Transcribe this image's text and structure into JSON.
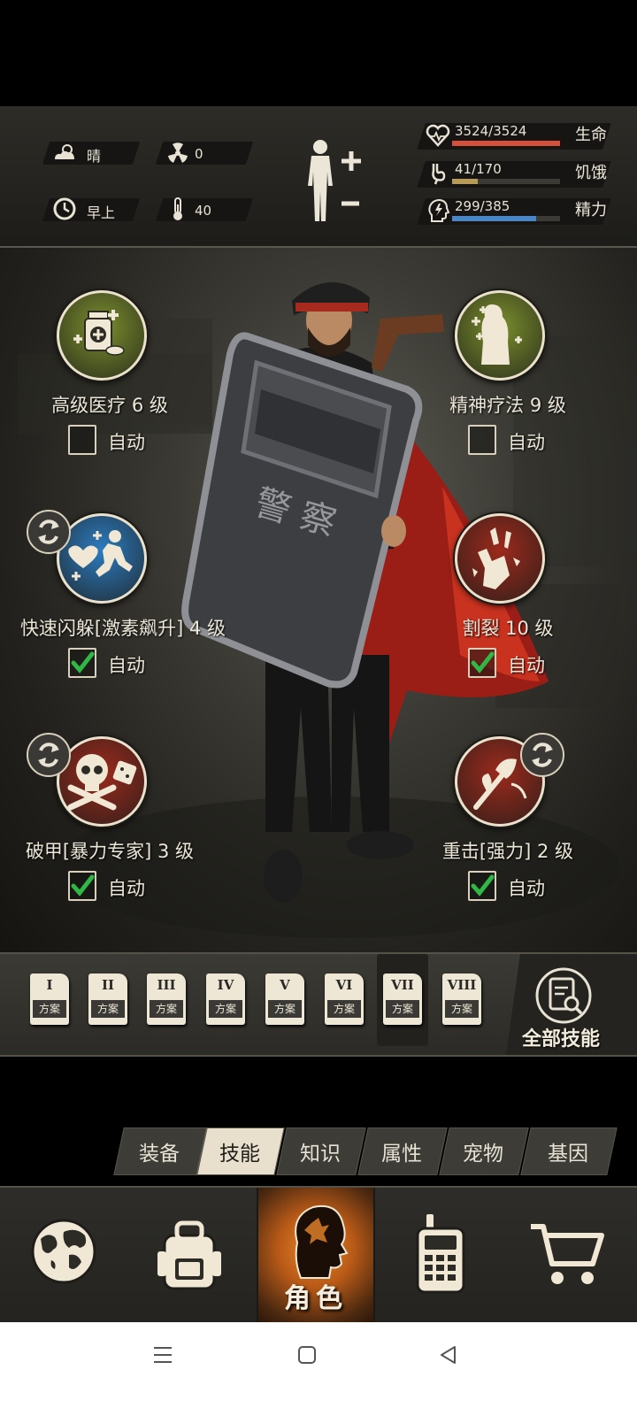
{
  "hud": {
    "weather": "晴",
    "radiation": "0",
    "time_of_day": "早上",
    "temperature": "40",
    "stats": [
      {
        "value": "3524/3524",
        "name": "生命",
        "fill": 1.0,
        "color": "#d4503c",
        "icon": "heart-icon"
      },
      {
        "value": "41/170",
        "name": "饥饿",
        "fill": 0.24,
        "color": "#b89a58",
        "icon": "stomach-icon"
      },
      {
        "value": "299/385",
        "name": "精力",
        "fill": 0.78,
        "color": "#4a86c6",
        "icon": "head-energy-icon"
      }
    ]
  },
  "skills": [
    {
      "name": "高级医疗 6 级",
      "auto_label": "自动",
      "auto": false,
      "swappable": false,
      "icon": "medkit-icon",
      "color": "#7a8f2c"
    },
    {
      "name": "精神疗法 9 级",
      "auto_label": "自动",
      "auto": false,
      "swappable": false,
      "icon": "ghost-heal-icon",
      "color": "#7a8f2c"
    },
    {
      "name": "快速闪躲[激素飙升] 4 级",
      "auto_label": "自动",
      "auto": true,
      "swappable": true,
      "icon": "dodge-icon",
      "color": "#2b7cc0"
    },
    {
      "name": "割裂 10 级",
      "auto_label": "自动",
      "auto": true,
      "swappable": false,
      "icon": "laceration-icon",
      "color": "#9c2a1c"
    },
    {
      "name": "破甲[暴力专家] 3 级",
      "auto_label": "自动",
      "auto": true,
      "swappable": true,
      "icon": "skull-dice-icon",
      "color": "#9c2a1c"
    },
    {
      "name": "重击[强力] 2 级",
      "auto_label": "自动",
      "auto": true,
      "swappable": true,
      "icon": "heavy-strike-icon",
      "color": "#9c2a1c"
    }
  ],
  "presets": {
    "items": [
      {
        "numeral": "I",
        "label": "方案"
      },
      {
        "numeral": "II",
        "label": "方案"
      },
      {
        "numeral": "III",
        "label": "方案"
      },
      {
        "numeral": "IV",
        "label": "方案"
      },
      {
        "numeral": "V",
        "label": "方案"
      },
      {
        "numeral": "VI",
        "label": "方案"
      },
      {
        "numeral": "VII",
        "label": "方案"
      },
      {
        "numeral": "VIII",
        "label": "方案"
      }
    ],
    "selected": "VII",
    "all_skills_label": "全部技能"
  },
  "tabs": [
    {
      "label": "装备"
    },
    {
      "label": "技能",
      "active": true
    },
    {
      "label": "知识"
    },
    {
      "label": "属性"
    },
    {
      "label": "宠物"
    },
    {
      "label": "基因"
    }
  ],
  "bottom_nav": {
    "role_label": "角色",
    "items": [
      "globe-icon",
      "backpack-icon",
      "role-icon",
      "walkie-talkie-icon",
      "cart-icon"
    ]
  },
  "shield_text": "警 察"
}
